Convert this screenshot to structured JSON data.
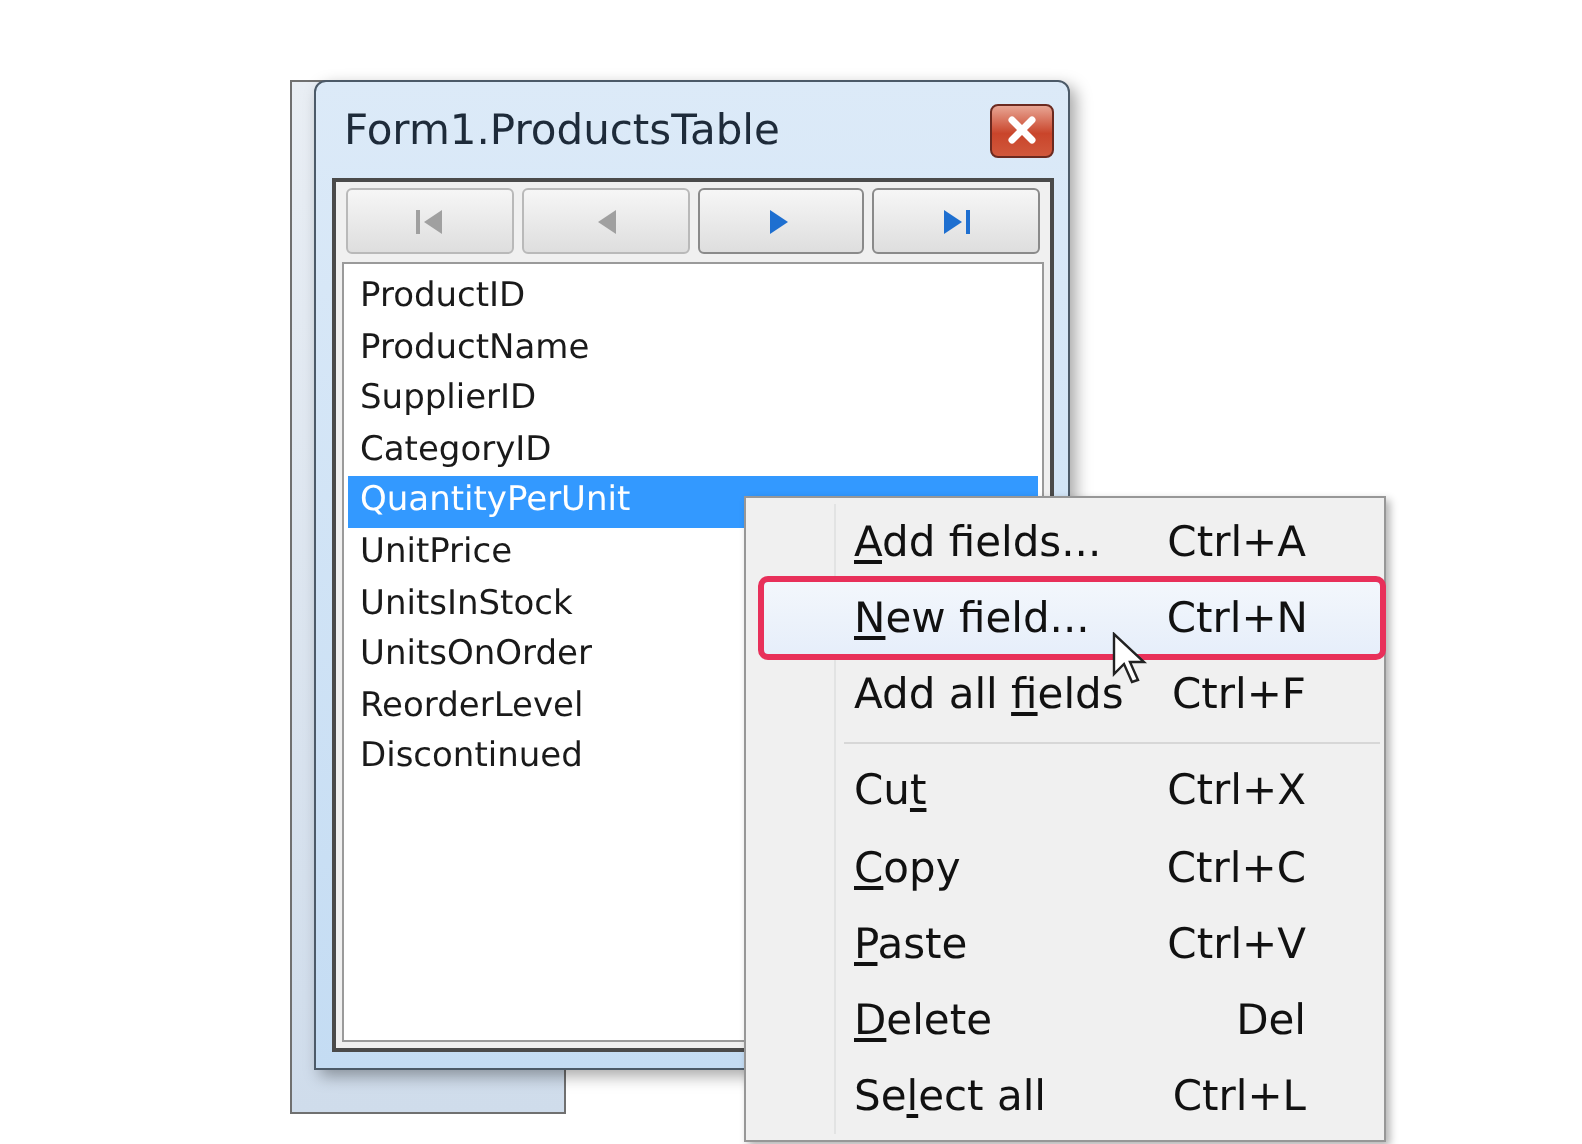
{
  "window": {
    "title": "Form1.ProductsTable"
  },
  "navigator": [
    {
      "kind": "first",
      "disabled": true
    },
    {
      "kind": "previous",
      "disabled": true
    },
    {
      "kind": "next",
      "disabled": false
    },
    {
      "kind": "last",
      "disabled": false
    }
  ],
  "fields": [
    {
      "label": "ProductID",
      "selected": false
    },
    {
      "label": "ProductName",
      "selected": false
    },
    {
      "label": "SupplierID",
      "selected": false
    },
    {
      "label": "CategoryID",
      "selected": false
    },
    {
      "label": "QuantityPerUnit",
      "selected": true
    },
    {
      "label": "UnitPrice",
      "selected": false
    },
    {
      "label": "UnitsInStock",
      "selected": false
    },
    {
      "label": "UnitsOnOrder",
      "selected": false
    },
    {
      "label": "ReorderLevel",
      "selected": false
    },
    {
      "label": "Discontinued",
      "selected": false
    }
  ],
  "context_menu": {
    "items": [
      {
        "kind": "item",
        "key": "A",
        "after": "dd fields...",
        "shortcut": "Ctrl+A",
        "highlighted": false,
        "annotated": false
      },
      {
        "kind": "item",
        "key": "N",
        "after": "ew field...",
        "shortcut": "Ctrl+N",
        "highlighted": true,
        "annotated": true
      },
      {
        "kind": "item",
        "before": "Add all ",
        "key": "f",
        "after": "ields",
        "shortcut": "Ctrl+F",
        "highlighted": false,
        "annotated": false
      },
      {
        "kind": "separator"
      },
      {
        "kind": "item",
        "before": "Cu",
        "key": "t",
        "shortcut": "Ctrl+X",
        "highlighted": false,
        "annotated": false
      },
      {
        "kind": "item",
        "key": "C",
        "after": "opy",
        "shortcut": "Ctrl+C",
        "highlighted": false,
        "annotated": false
      },
      {
        "kind": "item",
        "key": "P",
        "after": "aste",
        "shortcut": "Ctrl+V",
        "highlighted": false,
        "annotated": false
      },
      {
        "kind": "item",
        "key": "D",
        "after": "elete",
        "shortcut": "Del",
        "highlighted": false,
        "annotated": false
      },
      {
        "kind": "item",
        "before": "Se",
        "key": "l",
        "after": "ect all",
        "shortcut": "Ctrl+L",
        "highlighted": false,
        "annotated": false
      }
    ]
  }
}
